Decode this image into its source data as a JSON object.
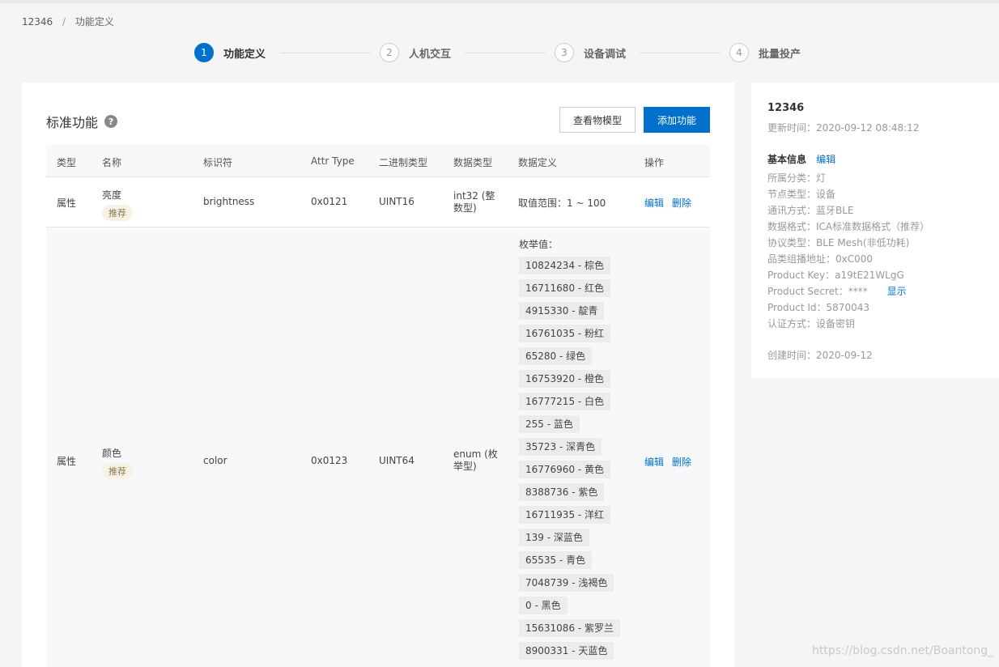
{
  "breadcrumb": {
    "root": "12346",
    "sep": "/",
    "current": "功能定义"
  },
  "steps": [
    {
      "num": "1",
      "label": "功能定义"
    },
    {
      "num": "2",
      "label": "人机交互"
    },
    {
      "num": "3",
      "label": "设备调试"
    },
    {
      "num": "4",
      "label": "批量投产"
    }
  ],
  "main": {
    "title": "标准功能",
    "help": "?",
    "btn_view": "查看物模型",
    "btn_add": "添加功能"
  },
  "table": {
    "headers": [
      "类型",
      "名称",
      "标识符",
      "Attr Type",
      "二进制类型",
      "数据类型",
      "数据定义",
      "操作"
    ],
    "rows": [
      {
        "type": "属性",
        "name": "亮度",
        "tag": "推荐",
        "identifier": "brightness",
        "attr_type": "0x0121",
        "binary_type": "UINT16",
        "data_type": "int32 (整数型)",
        "definition": "取值范围：1 ~ 100",
        "edit": "编辑",
        "delete": "删除"
      },
      {
        "type": "属性",
        "name": "颜色",
        "tag": "推荐",
        "identifier": "color",
        "attr_type": "0x0123",
        "binary_type": "UINT64",
        "data_type": "enum (枚举型)",
        "enum_title": "枚举值：",
        "enum_values": [
          "10824234 - 棕色",
          "16711680 - 红色",
          "4915330 - 靛青",
          "16761035 - 粉红",
          "65280 - 绿色",
          "16753920 - 橙色",
          "16777215 - 白色",
          "255 - 蓝色",
          "35723 - 深青色",
          "16776960 - 黄色",
          "8388736 - 紫色",
          "16711935 - 洋红",
          "139 - 深蓝色",
          "65535 - 青色",
          "7048739 - 浅褐色",
          "0 - 黑色",
          "15631086 - 紫罗兰",
          "8900331 - 天蓝色"
        ],
        "edit": "编辑",
        "delete": "删除"
      }
    ]
  },
  "side": {
    "product_name": "12346",
    "updated": "更新时间：2020-09-12 08:48:12",
    "section_title": "基本信息",
    "section_edit": "编辑",
    "info": [
      "所属分类：灯",
      "节点类型：设备",
      "通讯方式：蓝牙BLE",
      "数据格式：ICA标准数据格式（推荐）",
      "协议类型：BLE Mesh(非低功耗)",
      "品类组播地址：0xC000",
      "Product Key：a19tE21WLgG",
      "Product Secret：****",
      "Product Id：5870043",
      "认证方式：设备密钥"
    ],
    "show_link": "显示",
    "created": "创建时间：2020-09-12"
  },
  "watermark": "https://blog.csdn.net/Boantong_",
  "colors": {
    "primary": "#0070cc",
    "tag_bg": "#f6f2e6"
  }
}
